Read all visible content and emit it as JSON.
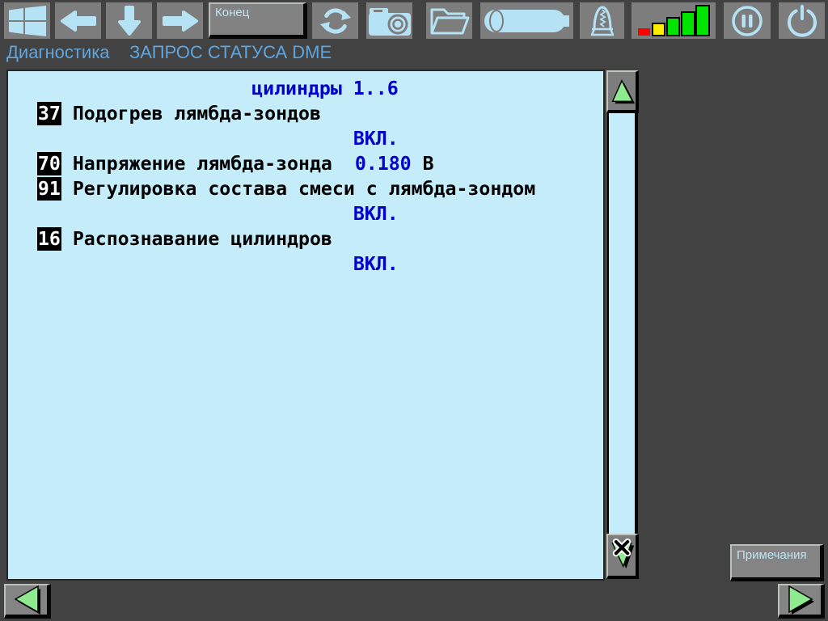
{
  "header": {
    "app_title": "Диагностика",
    "screen_title": "ЗАПРОС СТАТУСА DME"
  },
  "toolbar": {
    "end_button_label": "Конец",
    "icons": [
      "windows-logo",
      "arrow-left",
      "arrow-down",
      "arrow-right",
      "refresh",
      "camera",
      "folder",
      "cylinder",
      "lamp",
      "signal-bars",
      "pause",
      "power"
    ]
  },
  "status_screen": {
    "header_line": "цилиндры 1..6",
    "items": [
      {
        "id": "37",
        "label": "Подогрев лямбда-зондов",
        "value": "ВКЛ.",
        "value_inline": false
      },
      {
        "id": "70",
        "label": "Напряжение лямбда-зонда",
        "value": "0.180",
        "unit": "В",
        "value_inline": true
      },
      {
        "id": "91",
        "label": "Регулировка состава смеси с лямбда-зондом",
        "value": "ВКЛ.",
        "value_inline": false
      },
      {
        "id": "16",
        "label": "Распознавание цилиндров",
        "value": "ВКЛ.",
        "value_inline": false
      }
    ]
  },
  "scrollbar": {
    "up_icon": "triangle-up",
    "down_icon": "triangle-down-close"
  },
  "footer": {
    "notes_button_label": "Примечания",
    "prev_icon": "triangle-left",
    "next_icon": "triangle-right"
  },
  "colors": {
    "background": "#424242",
    "button_gray": "#7D7D7D",
    "icon_blue": "#B5E2F4",
    "title_blue": "#5FA5DE",
    "content_bg": "#C5EDF9",
    "value_blue": "#0000CD",
    "triangle_green": "#8FE98F",
    "bar_red": "#FF0000",
    "bar_yellow": "#FFEE00",
    "bar_green": "#00E400"
  }
}
